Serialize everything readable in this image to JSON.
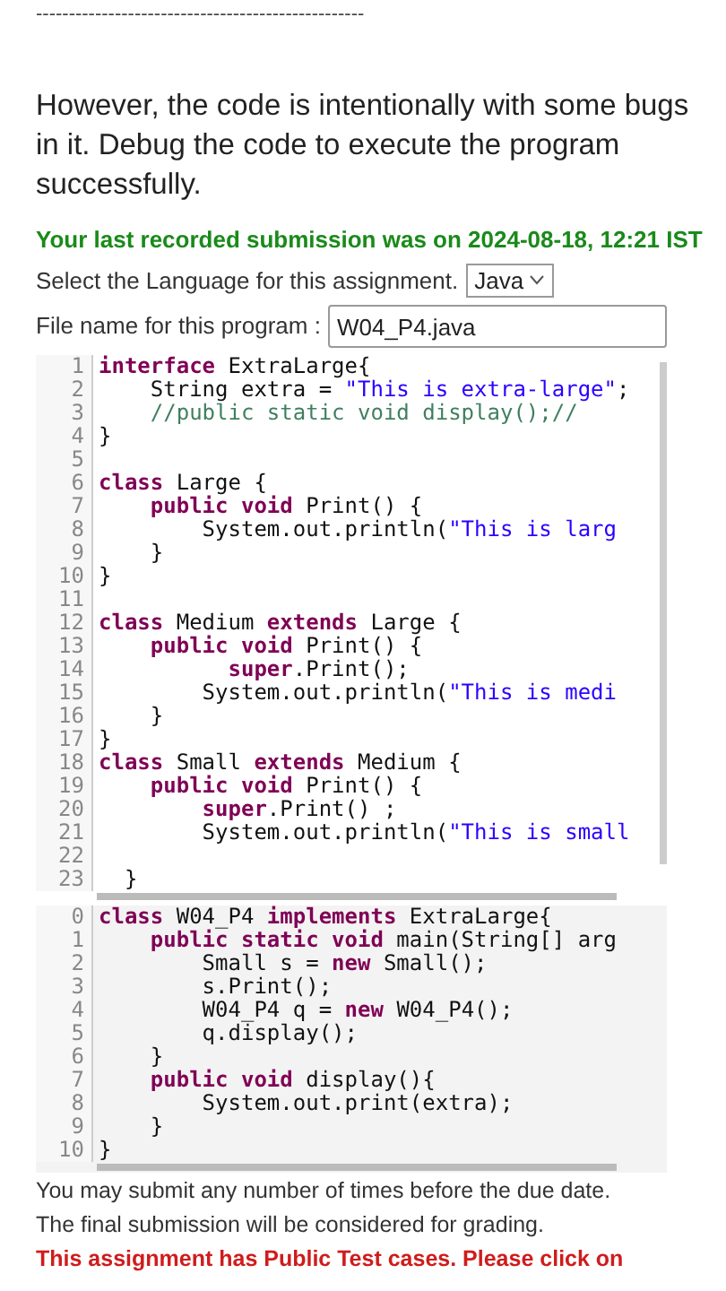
{
  "separator": "--------------------------------------------------",
  "intro": "However, the code is intentionally with some bugs in it. Debug the code to execute the program successfully.",
  "last_submission": "Your last recorded submission was on 2024-08-18, 12:21 IST",
  "language": {
    "label": "Select the Language for this assignment.",
    "value": "Java"
  },
  "file_name": {
    "label": "File name for this program :",
    "value": "W04_P4.java"
  },
  "editors": [
    {
      "kind": "editable",
      "lines": [
        {
          "number": "1",
          "tokens": [
            {
              "kind": "kw",
              "text": "interface"
            },
            {
              "kind": "plain",
              "text": " ExtraLarge{"
            }
          ]
        },
        {
          "number": "2",
          "tokens": [
            {
              "kind": "plain",
              "text": "    String extra = "
            },
            {
              "kind": "str",
              "text": "\"This is extra-large\""
            },
            {
              "kind": "plain",
              "text": ";"
            }
          ]
        },
        {
          "number": "3",
          "tokens": [
            {
              "kind": "comment",
              "text": "    //public static void display();//"
            }
          ]
        },
        {
          "number": "4",
          "tokens": [
            {
              "kind": "plain",
              "text": "}"
            }
          ]
        },
        {
          "number": "5"
        },
        {
          "number": "6",
          "tokens": [
            {
              "kind": "kw",
              "text": "class"
            },
            {
              "kind": "plain",
              "text": " Large {"
            }
          ]
        },
        {
          "number": "7",
          "tokens": [
            {
              "kind": "kw",
              "text": "    public void"
            },
            {
              "kind": "plain",
              "text": " Print() {"
            }
          ]
        },
        {
          "number": "8",
          "tokens": [
            {
              "kind": "plain",
              "text": "        System.out.println("
            },
            {
              "kind": "str",
              "text": "\"This is larg"
            }
          ]
        },
        {
          "number": "9",
          "tokens": [
            {
              "kind": "plain",
              "text": "    }"
            }
          ]
        },
        {
          "number": "10",
          "tokens": [
            {
              "kind": "plain",
              "text": "}"
            }
          ]
        },
        {
          "number": "11"
        },
        {
          "number": "12",
          "tokens": [
            {
              "kind": "kw",
              "text": "class"
            },
            {
              "kind": "plain",
              "text": " Medium "
            },
            {
              "kind": "kw",
              "text": "extends"
            },
            {
              "kind": "plain",
              "text": " Large {"
            }
          ]
        },
        {
          "number": "13",
          "tokens": [
            {
              "kind": "kw",
              "text": "    public void"
            },
            {
              "kind": "plain",
              "text": " Print() {"
            }
          ]
        },
        {
          "number": "14",
          "tokens": [
            {
              "kind": "kw",
              "text": "          super"
            },
            {
              "kind": "plain",
              "text": ".Print();"
            }
          ]
        },
        {
          "number": "15",
          "tokens": [
            {
              "kind": "plain",
              "text": "        System.out.println("
            },
            {
              "kind": "str",
              "text": "\"This is medi"
            }
          ]
        },
        {
          "number": "16",
          "tokens": [
            {
              "kind": "plain",
              "text": "    }"
            }
          ]
        },
        {
          "number": "17",
          "tokens": [
            {
              "kind": "plain",
              "text": "}"
            }
          ]
        },
        {
          "number": "18",
          "tokens": [
            {
              "kind": "kw",
              "text": "class"
            },
            {
              "kind": "plain",
              "text": " Small "
            },
            {
              "kind": "kw",
              "text": "extends"
            },
            {
              "kind": "plain",
              "text": " Medium {"
            }
          ]
        },
        {
          "number": "19",
          "tokens": [
            {
              "kind": "kw",
              "text": "    public void"
            },
            {
              "kind": "plain",
              "text": " Print() {"
            }
          ]
        },
        {
          "number": "20",
          "tokens": [
            {
              "kind": "kw",
              "text": "        super"
            },
            {
              "kind": "plain",
              "text": ".Print() ;"
            }
          ]
        },
        {
          "number": "21",
          "tokens": [
            {
              "kind": "plain",
              "text": "        System.out.println("
            },
            {
              "kind": "str",
              "text": "\"This is small"
            }
          ]
        },
        {
          "number": "22"
        },
        {
          "number": "23",
          "tokens": [
            {
              "kind": "plain",
              "text": "  }"
            }
          ]
        }
      ]
    },
    {
      "kind": "readonly",
      "lines": [
        {
          "number": "0",
          "tokens": [
            {
              "kind": "kw",
              "text": "class"
            },
            {
              "kind": "plain",
              "text": " W04_P4 "
            },
            {
              "kind": "kw",
              "text": "implements"
            },
            {
              "kind": "plain",
              "text": " ExtraLarge{"
            }
          ]
        },
        {
          "number": "1",
          "tokens": [
            {
              "kind": "kw",
              "text": "    public static void"
            },
            {
              "kind": "plain",
              "text": " main(String[] arg"
            }
          ]
        },
        {
          "number": "2",
          "tokens": [
            {
              "kind": "plain",
              "text": "        Small s = "
            },
            {
              "kind": "kw",
              "text": "new"
            },
            {
              "kind": "plain",
              "text": " Small();"
            }
          ]
        },
        {
          "number": "3",
          "tokens": [
            {
              "kind": "plain",
              "text": "        s.Print();"
            }
          ]
        },
        {
          "number": "4",
          "tokens": [
            {
              "kind": "plain",
              "text": "        W04_P4 q = "
            },
            {
              "kind": "kw",
              "text": "new"
            },
            {
              "kind": "plain",
              "text": " W04_P4();"
            }
          ]
        },
        {
          "number": "5",
          "tokens": [
            {
              "kind": "plain",
              "text": "        q.display();"
            }
          ]
        },
        {
          "number": "6",
          "tokens": [
            {
              "kind": "plain",
              "text": "    }"
            }
          ]
        },
        {
          "number": "7",
          "tokens": [
            {
              "kind": "kw",
              "text": "    public void"
            },
            {
              "kind": "plain",
              "text": " display(){"
            }
          ]
        },
        {
          "number": "8",
          "tokens": [
            {
              "kind": "plain",
              "text": "        System.out.print(extra);"
            }
          ]
        },
        {
          "number": "9",
          "tokens": [
            {
              "kind": "plain",
              "text": "    }"
            }
          ]
        },
        {
          "number": "10",
          "tokens": [
            {
              "kind": "plain",
              "text": "}"
            }
          ]
        }
      ]
    }
  ],
  "notes": [
    {
      "kind": "normal",
      "text": "You may submit any number of times before the due date."
    },
    {
      "kind": "normal",
      "text": "The final submission will be considered for grading."
    },
    {
      "kind": "warning",
      "text": "This assignment has Public Test cases. Please click on"
    }
  ]
}
